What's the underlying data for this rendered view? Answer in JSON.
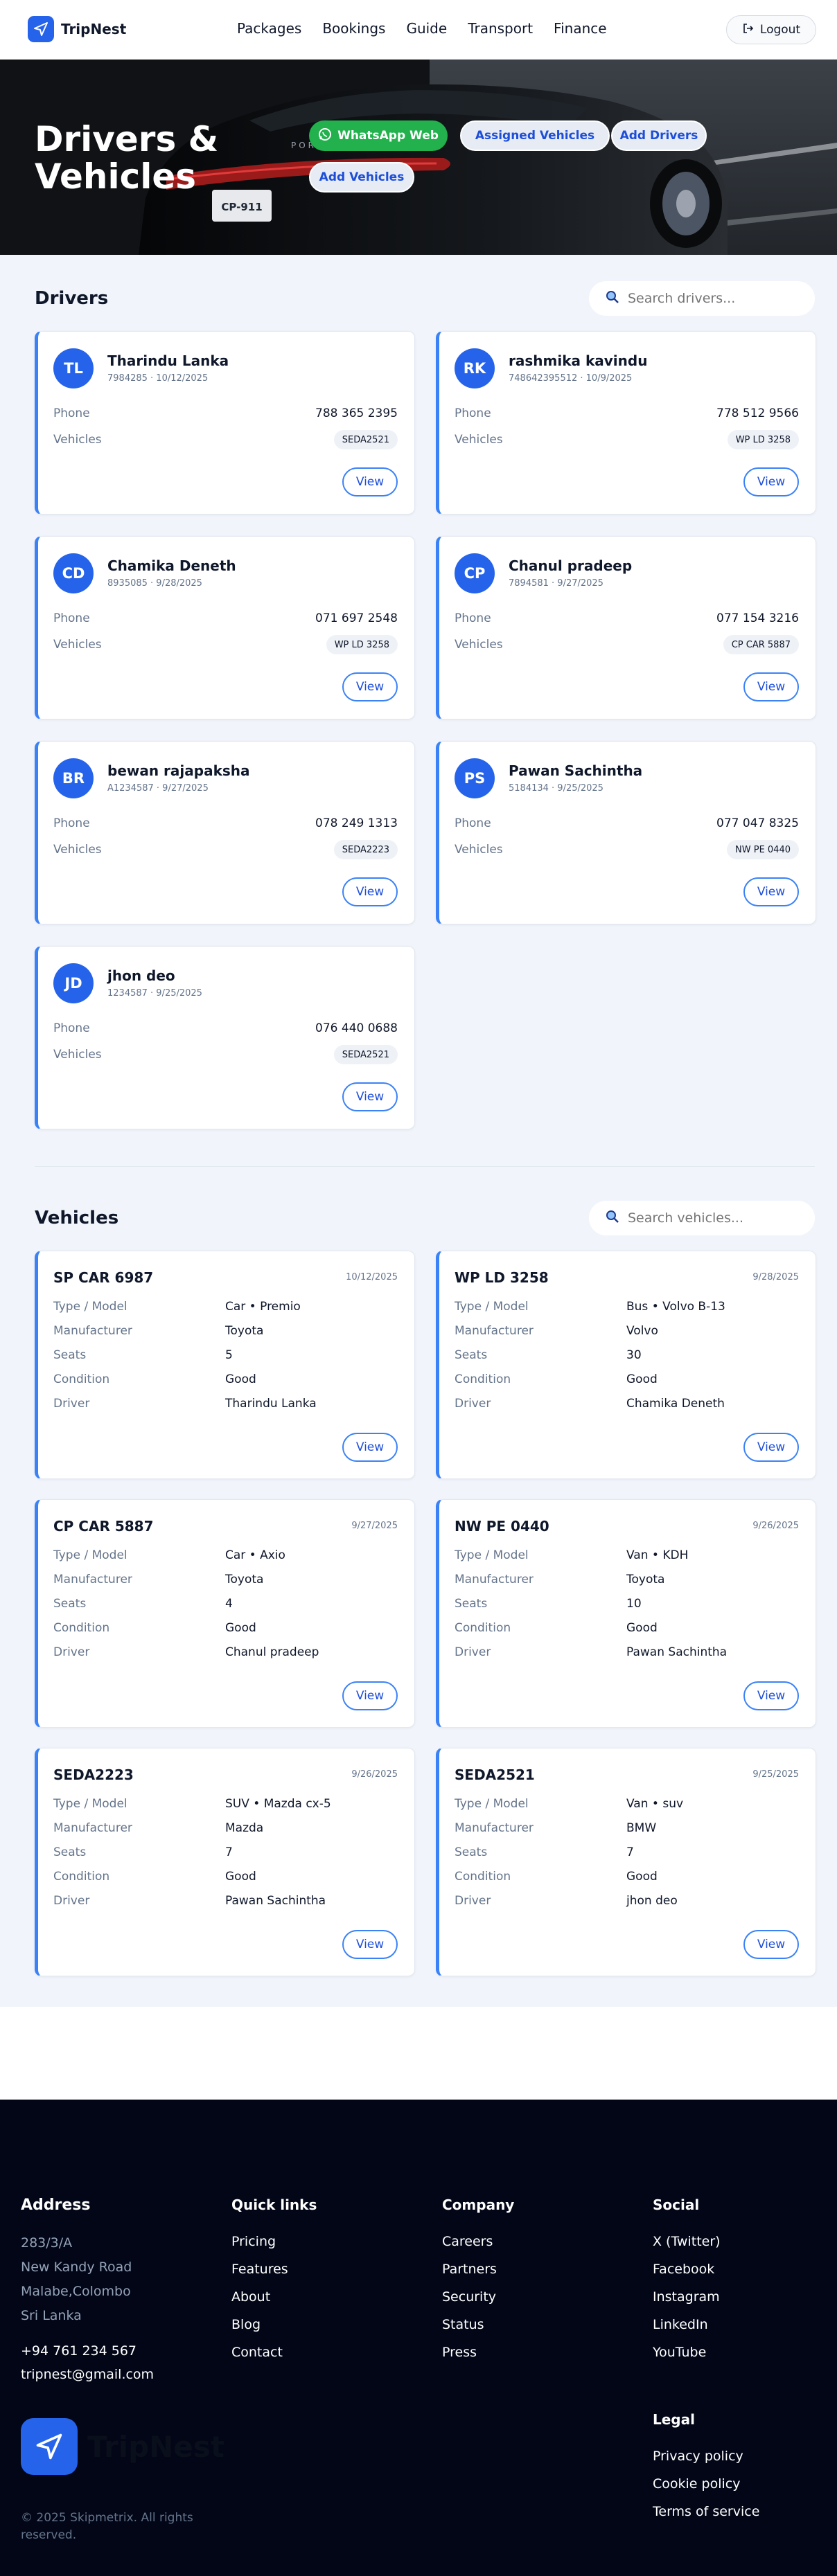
{
  "brand": {
    "name": "TripNest"
  },
  "nav": [
    "Packages",
    "Bookings",
    "Guide",
    "Transport",
    "Finance"
  ],
  "logout": "Logout",
  "hero": {
    "title_line1": "Drivers &",
    "title_line2": "Vehicles",
    "whatsapp": "WhatsApp Web",
    "assigned": "Assigned Vehicles",
    "add_drivers": "Add Drivers",
    "add_vehicles": "Add Vehicles",
    "car_plate": "CP-911",
    "car_brand": "PORSCHE"
  },
  "drivers_section": {
    "title": "Drivers",
    "search_placeholder": "Search drivers...",
    "phone_label": "Phone",
    "vehicles_label": "Vehicles",
    "view": "View"
  },
  "drivers": [
    {
      "initials": "TL",
      "name": "Tharindu Lanka",
      "sub": "7984285 · 10/12/2025",
      "phone": "788 365 2395",
      "vehicle": "SEDA2521"
    },
    {
      "initials": "RK",
      "name": "rashmika kavindu",
      "sub": "748642395512 · 10/9/2025",
      "phone": "778 512 9566",
      "vehicle": "WP LD 3258"
    },
    {
      "initials": "CD",
      "name": "Chamika Deneth",
      "sub": "8935085 · 9/28/2025",
      "phone": "071 697 2548",
      "vehicle": "WP LD 3258"
    },
    {
      "initials": "CP",
      "name": "Chanul pradeep",
      "sub": "7894581 · 9/27/2025",
      "phone": "077 154 3216",
      "vehicle": "CP CAR 5887"
    },
    {
      "initials": "BR",
      "name": "bewan rajapaksha",
      "sub": "A1234587 · 9/27/2025",
      "phone": "078 249 1313",
      "vehicle": "SEDA2223"
    },
    {
      "initials": "PS",
      "name": "Pawan Sachintha",
      "sub": "5184134 · 9/25/2025",
      "phone": "077 047 8325",
      "vehicle": "NW PE 0440"
    },
    {
      "initials": "JD",
      "name": "jhon deo",
      "sub": "1234587 · 9/25/2025",
      "phone": "076 440 0688",
      "vehicle": "SEDA2521"
    }
  ],
  "vehicles_section": {
    "title": "Vehicles",
    "search_placeholder": "Search vehicles...",
    "labels": {
      "type": "Type / Model",
      "manufacturer": "Manufacturer",
      "seats": "Seats",
      "condition": "Condition",
      "driver": "Driver"
    },
    "view": "View"
  },
  "vehicles": [
    {
      "plate": "SP CAR 6987",
      "date": "10/12/2025",
      "type": "Car • Premio",
      "manufacturer": "Toyota",
      "seats": "5",
      "condition": "Good",
      "driver": "Tharindu Lanka"
    },
    {
      "plate": "WP LD 3258",
      "date": "9/28/2025",
      "type": "Bus • Volvo B-13",
      "manufacturer": "Volvo",
      "seats": "30",
      "condition": "Good",
      "driver": "Chamika Deneth"
    },
    {
      "plate": "CP CAR 5887",
      "date": "9/27/2025",
      "type": "Car • Axio",
      "manufacturer": "Toyota",
      "seats": "4",
      "condition": "Good",
      "driver": "Chanul pradeep"
    },
    {
      "plate": "NW PE 0440",
      "date": "9/26/2025",
      "type": "Van • KDH",
      "manufacturer": "Toyota",
      "seats": "10",
      "condition": "Good",
      "driver": "Pawan Sachintha"
    },
    {
      "plate": "SEDA2223",
      "date": "9/26/2025",
      "type": "SUV • Mazda cx-5",
      "manufacturer": "Mazda",
      "seats": "7",
      "condition": "Good",
      "driver": "Pawan Sachintha"
    },
    {
      "plate": "SEDA2521",
      "date": "9/25/2025",
      "type": "Van • suv",
      "manufacturer": "BMW",
      "seats": "7",
      "condition": "Good",
      "driver": "jhon deo"
    }
  ],
  "footer": {
    "address": {
      "title": "Address",
      "lines": [
        "283/3/A",
        "New Kandy Road",
        "Malabe,Colombo",
        "Sri Lanka"
      ],
      "phone": "+94 761 234 567",
      "email": "tripnest@gmail.com"
    },
    "quick_links": {
      "title": "Quick links",
      "items": [
        "Pricing",
        "Features",
        "About",
        "Blog",
        "Contact"
      ]
    },
    "company": {
      "title": "Company",
      "items": [
        "Careers",
        "Partners",
        "Security",
        "Status",
        "Press"
      ]
    },
    "social": {
      "title": "Social",
      "items": [
        "X (Twitter)",
        "Facebook",
        "Instagram",
        "LinkedIn",
        "YouTube"
      ]
    },
    "legal": {
      "title": "Legal",
      "items": [
        "Privacy policy",
        "Cookie policy",
        "Terms of service"
      ]
    },
    "brand_name": "TripNest",
    "copyright": "© 2025 Skipmetrix. All rights reserved."
  },
  "colors": {
    "primary": "#2563eb",
    "accent_border": "#3b82f6",
    "whatsapp": "#22b14c",
    "footer_bg": "#020617",
    "page_bg": "#f1f5fb"
  }
}
